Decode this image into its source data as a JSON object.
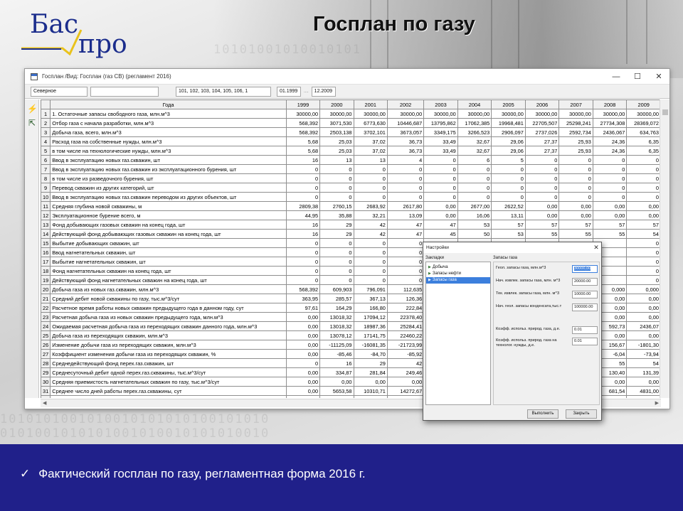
{
  "slide": {
    "logo_top": "Бас",
    "logo_bottom": "про",
    "title": "Госплан по газу",
    "footer_check": "✓",
    "footer_text": "Фактический госплан по газу, регламентная форма 2016 г.",
    "colors": {
      "footer_bg": "#20208a",
      "logo_blue": "#1b2d8c",
      "logo_check_yellow": "#e9c21b",
      "selection_blue": "#3c7fdd"
    }
  },
  "window": {
    "title": "Госплан /Вид: Госплан (газ СВ) (регламент 2016)",
    "controls": {
      "minimize": "—",
      "maximize": "☐",
      "close": "✕"
    },
    "filter": {
      "region": "Северное",
      "empty_box": "",
      "codes": "101, 102, 103, 104, 105, 106, 1",
      "date_from": "01.1999",
      "date_sep": "....",
      "date_to": "12.2009"
    },
    "toolbar_icons": [
      "lightning-icon",
      "exit-door-icon"
    ]
  },
  "grid": {
    "header_label": "Года",
    "years": [
      "1999",
      "2000",
      "2001",
      "2002",
      "2003",
      "2004",
      "2005",
      "2006",
      "2007",
      "2008",
      "2009"
    ],
    "rows": [
      {
        "n": "1",
        "name": "1. Остаточные запасы свободного газа, млн.м^3",
        "v": [
          "30000,00",
          "30000,00",
          "30000,00",
          "30000,00",
          "30000,00",
          "30000,00",
          "30000,00",
          "30000,00",
          "30000,00",
          "30000,00",
          "30000,00"
        ]
      },
      {
        "n": "2",
        "name": "Отбор газа с начала разработки, млн.м^3",
        "v": [
          "568,392",
          "3071,530",
          "6773,630",
          "10446,687",
          "13795,862",
          "17062,385",
          "19968,481",
          "22705,507",
          "25298,241",
          "27734,308",
          "28369,072"
        ]
      },
      {
        "n": "3",
        "name": "Добыча газа, всего, млн.м^3",
        "v": [
          "568,392",
          "2503,138",
          "3702,101",
          "3673,057",
          "3349,175",
          "3266,523",
          "2906,097",
          "2737,026",
          "2592,734",
          "2436,067",
          "634,763"
        ]
      },
      {
        "n": "4",
        "name": "Расход газа на собственные нужды, млн.м^3",
        "v": [
          "5,68",
          "25,03",
          "37,02",
          "36,73",
          "33,49",
          "32,67",
          "29,06",
          "27,37",
          "25,93",
          "24,36",
          "6,35"
        ]
      },
      {
        "n": "5",
        "name": "в том числе на технологические нужды, млн.м^3",
        "v": [
          "5,68",
          "25,03",
          "37,02",
          "36,73",
          "33,49",
          "32,67",
          "29,06",
          "27,37",
          "25,93",
          "24,36",
          "6,35"
        ]
      },
      {
        "n": "6",
        "name": "Ввод в эксплуатацию новых газ.скважин, шт",
        "v": [
          "16",
          "13",
          "13",
          "4",
          "0",
          "6",
          "5",
          "0",
          "0",
          "0",
          "0"
        ]
      },
      {
        "n": "7",
        "name": "Ввод в эксплуатацию новых газ.скважин из эксплуатационного бурения, шт",
        "v": [
          "0",
          "0",
          "0",
          "0",
          "0",
          "0",
          "0",
          "0",
          "0",
          "0",
          "0"
        ]
      },
      {
        "n": "8",
        "name": "в том числе из разведочного бурения, шт",
        "v": [
          "0",
          "0",
          "0",
          "0",
          "0",
          "0",
          "0",
          "0",
          "0",
          "0",
          "0"
        ]
      },
      {
        "n": "9",
        "name": "Перевод скважин из других категорий, шт",
        "v": [
          "0",
          "0",
          "0",
          "0",
          "0",
          "0",
          "0",
          "0",
          "0",
          "0",
          "0"
        ]
      },
      {
        "n": "10",
        "name": "Ввод в эксплуатацию новых газ.скважин переводом из других объектов, шт",
        "v": [
          "0",
          "0",
          "0",
          "0",
          "0",
          "0",
          "0",
          "0",
          "0",
          "0",
          "0"
        ]
      },
      {
        "n": "11",
        "name": "Средняя глубина новой скважины, м",
        "v": [
          "2809,38",
          "2760,15",
          "2683,92",
          "2617,80",
          "0,00",
          "2677,00",
          "2622,52",
          "0,00",
          "0,00",
          "0,00",
          "0,00"
        ]
      },
      {
        "n": "12",
        "name": "Эксплуатационное бурение всего, м",
        "v": [
          "44,95",
          "35,88",
          "32,21",
          "13,09",
          "0,00",
          "16,06",
          "13,11",
          "0,00",
          "0,00",
          "0,00",
          "0,00"
        ]
      },
      {
        "n": "13",
        "name": "Фонд добывающих газовых скважин на конец года, шт",
        "v": [
          "16",
          "29",
          "42",
          "47",
          "47",
          "53",
          "57",
          "57",
          "57",
          "57",
          "57"
        ]
      },
      {
        "n": "14",
        "name": "Действующий фонд добывающих газовых скважин на конец года, шт",
        "v": [
          "16",
          "29",
          "42",
          "47",
          "45",
          "50",
          "53",
          "55",
          "55",
          "55",
          "54"
        ]
      },
      {
        "n": "15",
        "name": "Выбытие добывающих скважин, шт",
        "v": [
          "0",
          "0",
          "0",
          "0",
          "",
          "",
          "",
          "",
          "",
          "",
          "0"
        ]
      },
      {
        "n": "16",
        "name": "Ввод нагнетательных скважин, шт",
        "v": [
          "0",
          "0",
          "0",
          "0",
          "",
          "",
          "",
          "",
          "",
          "",
          "0"
        ]
      },
      {
        "n": "17",
        "name": "Выбытие нагнетательных скважин, шт",
        "v": [
          "0",
          "0",
          "0",
          "0",
          "",
          "",
          "",
          "",
          "",
          "",
          "0"
        ]
      },
      {
        "n": "18",
        "name": "Фонд нагнетательных скважин на конец года, шт",
        "v": [
          "0",
          "0",
          "0",
          "0",
          "",
          "",
          "",
          "",
          "",
          "",
          "0"
        ]
      },
      {
        "n": "19",
        "name": "Действующий фонд нагнетательных скважин на конец года, шт",
        "v": [
          "0",
          "0",
          "0",
          "0",
          "",
          "",
          "",
          "",
          "",
          "",
          "0"
        ]
      },
      {
        "n": "20",
        "name": "Добыча газа из новых газ.скважин, млн.м^3",
        "v": [
          "568,392",
          "609,903",
          "796,091",
          "112,635",
          "",
          "",
          "",
          "",
          "",
          "0,000",
          "0,000"
        ]
      },
      {
        "n": "21",
        "name": "Средний дебит новой скважины по газу, тыс.м^3/сут",
        "v": [
          "363,95",
          "285,57",
          "367,13",
          "126,36",
          "",
          "",
          "",
          "",
          "",
          "0,00",
          "0,00"
        ]
      },
      {
        "n": "22",
        "name": "Расчетное время работы новых скважин предыдущего года в данном году, сут",
        "v": [
          "97,61",
          "164,29",
          "166,80",
          "222,84",
          "",
          "",
          "",
          "",
          "",
          "0,00",
          "0,00"
        ]
      },
      {
        "n": "23",
        "name": "Расчетная добыча газа из новых скважин предыдущего года, млн.м^3",
        "v": [
          "0,00",
          "13018,32",
          "17094,12",
          "22378,40",
          "",
          "",
          "",
          "",
          "",
          "0,00",
          "0,00"
        ]
      },
      {
        "n": "24",
        "name": "Ожидаемая расчетная добыча газа из переходящих скважин данного года, млн.м^3",
        "v": [
          "0,00",
          "13018,32",
          "18987,36",
          "25284,41",
          "",
          "",
          "",
          "",
          "",
          "592,73",
          "2436,07"
        ]
      },
      {
        "n": "25",
        "name": "Добыча газа из переходящих скважин, млн.м^3",
        "v": [
          "0,00",
          "13078,12",
          "17141,75",
          "22460,22",
          "",
          "",
          "",
          "",
          "",
          "0,00",
          "0,00"
        ]
      },
      {
        "n": "26",
        "name": "Изменение добычи газа из переходящих скважин, млн.м^3",
        "v": [
          "0,00",
          "-11125,09",
          "-16081,35",
          "-21723,99",
          "",
          "",
          "",
          "",
          "",
          "156,67",
          "-1801,30"
        ]
      },
      {
        "n": "27",
        "name": "Коэффициент изменения добычи газа из переходящих скважин, %",
        "v": [
          "0,00",
          "-85,46",
          "-84,70",
          "-85,92",
          "",
          "",
          "",
          "",
          "",
          "-6,04",
          "-73,94"
        ]
      },
      {
        "n": "28",
        "name": "Среднедействующий фонд перех.газ.скважин, шт",
        "v": [
          "0",
          "16",
          "29",
          "42",
          "",
          "",
          "",
          "",
          "",
          "55",
          "54"
        ]
      },
      {
        "n": "29",
        "name": "Среднесуточный дебит одной перех.газ.скважины, тыс.м^3/сут",
        "v": [
          "0,00",
          "334,87",
          "281,84",
          "249,46",
          "",
          "",
          "",
          "",
          "",
          "130,40",
          "131,39"
        ]
      },
      {
        "n": "30",
        "name": "Средняя приемистость нагнетательных скважин по газу, тыс.м^3/сут",
        "v": [
          "0,00",
          "0,00",
          "0,00",
          "0,00",
          "",
          "",
          "",
          "",
          "",
          "0,00",
          "0,00"
        ]
      },
      {
        "n": "31",
        "name": "Среднее число дней работы перех.газ.скважины, сут",
        "v": [
          "0,00",
          "5653,58",
          "10310,71",
          "14272,67",
          "",
          "",
          "",
          "",
          "",
          "681,54",
          "4831,00"
        ]
      },
      {
        "n": "32",
        "name": "Закачка газа, млн.м^3",
        "v": [
          "0,00",
          "0,00",
          "0,00",
          "0,00",
          "",
          "",
          "",
          "",
          "",
          "0,00",
          "0,00"
        ]
      }
    ]
  },
  "dialog": {
    "title": "Настройки",
    "close": "✕",
    "left_label": "Закладки",
    "tabs": [
      "Добыча",
      "Запасы нефти",
      "Запасы газа"
    ],
    "selected_tab": 2,
    "right_label": "Запасы газа",
    "fields": [
      {
        "label": "Геол. запасы газа, млн.м^3",
        "value": "30000,00"
      },
      {
        "label": "Нач. извлек. запасы газа, млн. м^3",
        "value": "20000.00"
      },
      {
        "label": "Тек. извлек. запасы газа, млн. м^3",
        "value": "10000.00"
      },
      {
        "label": "Нач. геол. запасы конденсата,тыс.т",
        "value": "100000.00"
      },
      {
        "label": "Коэфф. использ. природ. газа, д.е.",
        "value": "0.01"
      },
      {
        "label": "Коэфф. использ. природ. газа на технолог. нужды, д.е.",
        "value": "0.01"
      }
    ],
    "run_button": "Выполнить",
    "close_button": "Закрыть"
  }
}
